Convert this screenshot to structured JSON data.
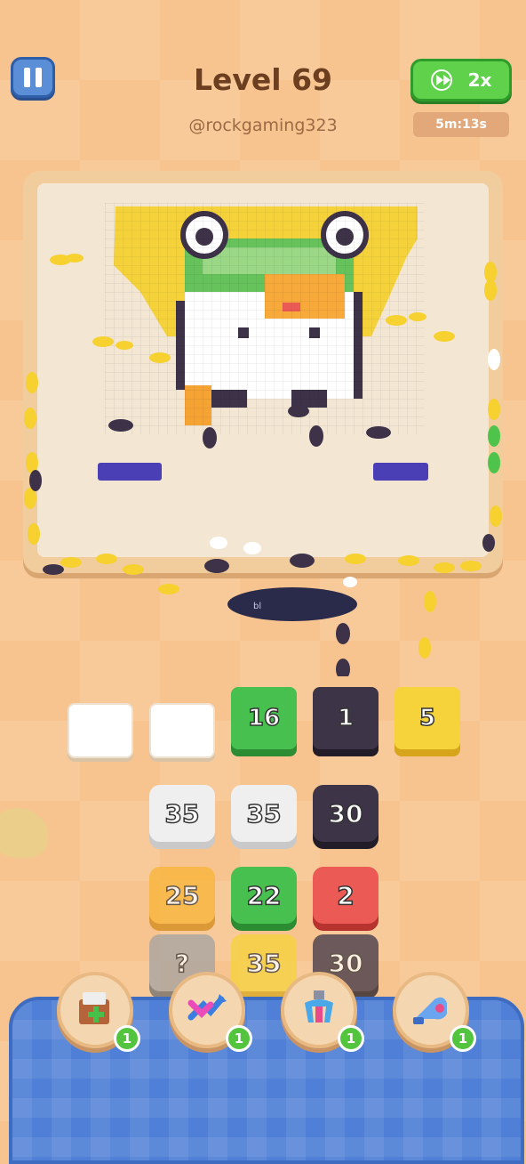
{
  "header": {
    "level_title": "Level 69",
    "username": "@rockgaming323",
    "speed_label": "2x",
    "timer": "5m:13s"
  },
  "board": {
    "hole_label": "bl"
  },
  "queue": [
    {
      "value": "",
      "color": "empty"
    },
    {
      "value": "",
      "color": "empty"
    },
    {
      "value": "16",
      "color": "green"
    },
    {
      "value": "1",
      "color": "dark"
    },
    {
      "value": "5",
      "color": "yellow"
    }
  ],
  "tiles": [
    [
      {
        "value": "35",
        "color": "white"
      },
      {
        "value": "35",
        "color": "white"
      },
      {
        "value": "30",
        "color": "dark"
      }
    ],
    [
      {
        "value": "25",
        "color": "orange"
      },
      {
        "value": "22",
        "color": "green"
      },
      {
        "value": "2",
        "color": "red"
      }
    ],
    [
      {
        "value": "?",
        "color": "grey"
      },
      {
        "value": "35",
        "color": "yellow"
      },
      {
        "value": "30",
        "color": "dark"
      }
    ]
  ],
  "powerups": [
    {
      "icon": "add-box-icon",
      "count": "1"
    },
    {
      "icon": "shuffle-arrows-icon",
      "count": "1"
    },
    {
      "icon": "magnet-claw-icon",
      "count": "1"
    },
    {
      "icon": "vacuum-icon",
      "count": "1"
    }
  ],
  "colors": {
    "green": "#47c04f",
    "dark": "#3e3447",
    "yellow": "#f6d33a",
    "white": "#efefef",
    "orange": "#f9b536",
    "red": "#ec5a55",
    "panel": "#4f7fd6"
  }
}
